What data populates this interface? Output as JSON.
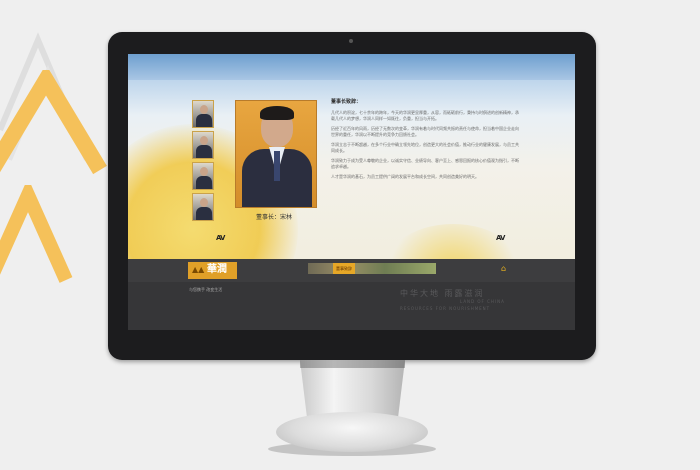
{
  "page": {
    "accent_color": "#e0a028",
    "background_color": "#efefef",
    "navbar_color": "#3d3d3f",
    "footer_color": "#363638"
  },
  "profile": {
    "heading": "董事长致辞：",
    "caption": "董事长：宋林",
    "paragraphs": [
      "几代人的积淀，七十余年的跨年，今天的华润更显厚重，从容，而砥砺前行，秉持与时俱进的创新精神，承载几代人的梦想，华润人同样一如既往，负重，担当与开拓。",
      "历经了近百年的风雨，历经了无数次的变革，华润有着与时代同频共振的责任与使命，担当着中国企业走向世界的重任，华润以不断提升的竞争力回馈社会。",
      "华润立志于不断超越，在多个行业中确立领先地位，创造更大的社会价值，推动行业的健康发展，与员工共同成长。",
      "华润致力于成为受人尊敬的企业，以诚实守信、业绩导向、客户至上、感恩回报的核心价值观为指引，不断追求卓越。",
      "人才是华润的基石，为员工提供广阔的发展平台和成长空间，共同创造美好的明天。"
    ],
    "arrow_left": "AV",
    "arrow_right": "AV"
  },
  "nav": {
    "logo_mark": "▲▲",
    "logo_text": "華潤",
    "slogan": "与您携手  改变生活",
    "strip_button": "董事致辞",
    "home_icon": "home-icon"
  },
  "footer": {
    "title": "中华大地  雨露滋润",
    "subtitle_line1": "LAND OF CHINA",
    "subtitle_line2": "RESOURCES FOR NOURISHMENT"
  }
}
